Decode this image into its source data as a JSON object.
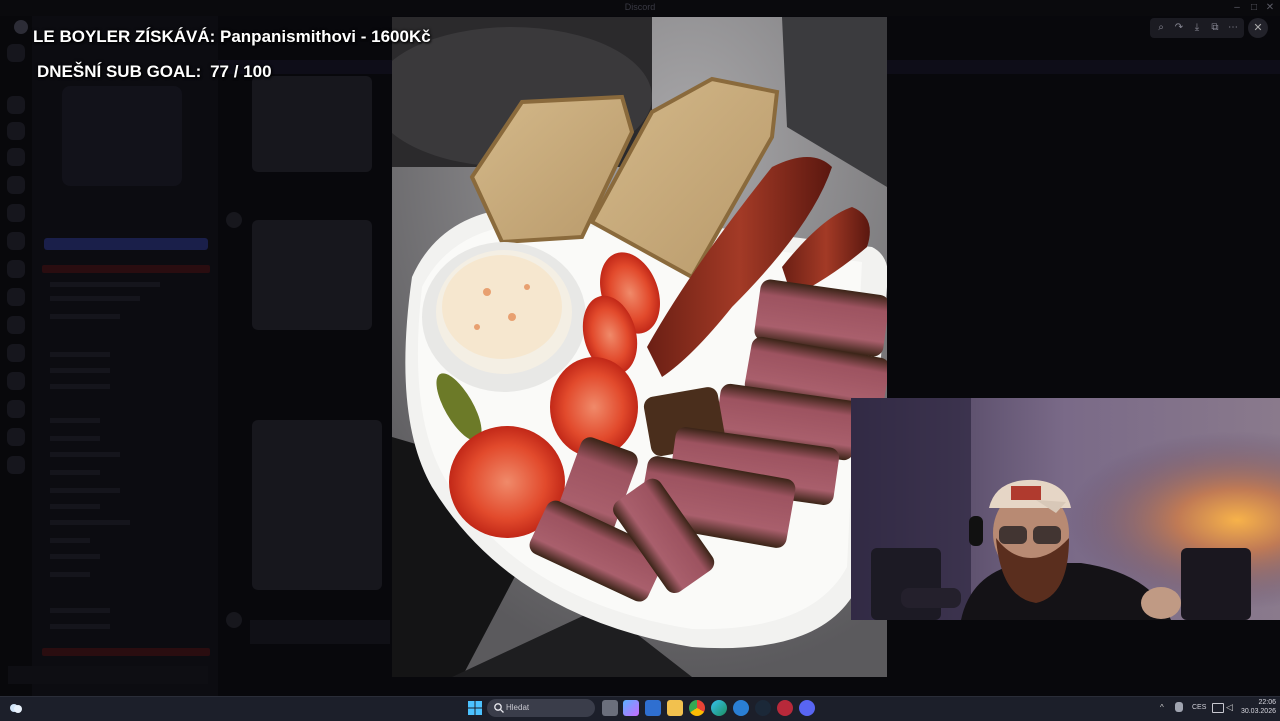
{
  "overlay": {
    "donation": "LE BOYLER ZÍSKÁVÁ: Panpanismithovi - 1600Kč",
    "subgoal_label": "DNEŠNÍ SUB GOAL:",
    "subgoal_value": "77 / 100",
    "subgoal_current": 77,
    "subgoal_target": 100
  },
  "window": {
    "title": "Discord"
  },
  "viewer_toolbar": {
    "buttons": [
      "zoom-icon",
      "forward-icon",
      "download-icon",
      "open-external-icon",
      "more-icon"
    ],
    "close_icon": "close-icon"
  },
  "taskbar": {
    "search_placeholder": "Hledat",
    "language": "CES",
    "time": "22:06",
    "date": "30.03.2026",
    "apps": [
      "file-explorer-icon",
      "copilot-icon",
      "store-icon",
      "folder-icon",
      "chrome-icon",
      "edge-icon",
      "steam-alt-icon",
      "steam-icon",
      "game-icon",
      "discord-icon"
    ]
  },
  "colors": {
    "taskbar_bg": "#1c1f2a",
    "accent_blue": "#3b82f6",
    "alert_red": "#c0392b"
  }
}
